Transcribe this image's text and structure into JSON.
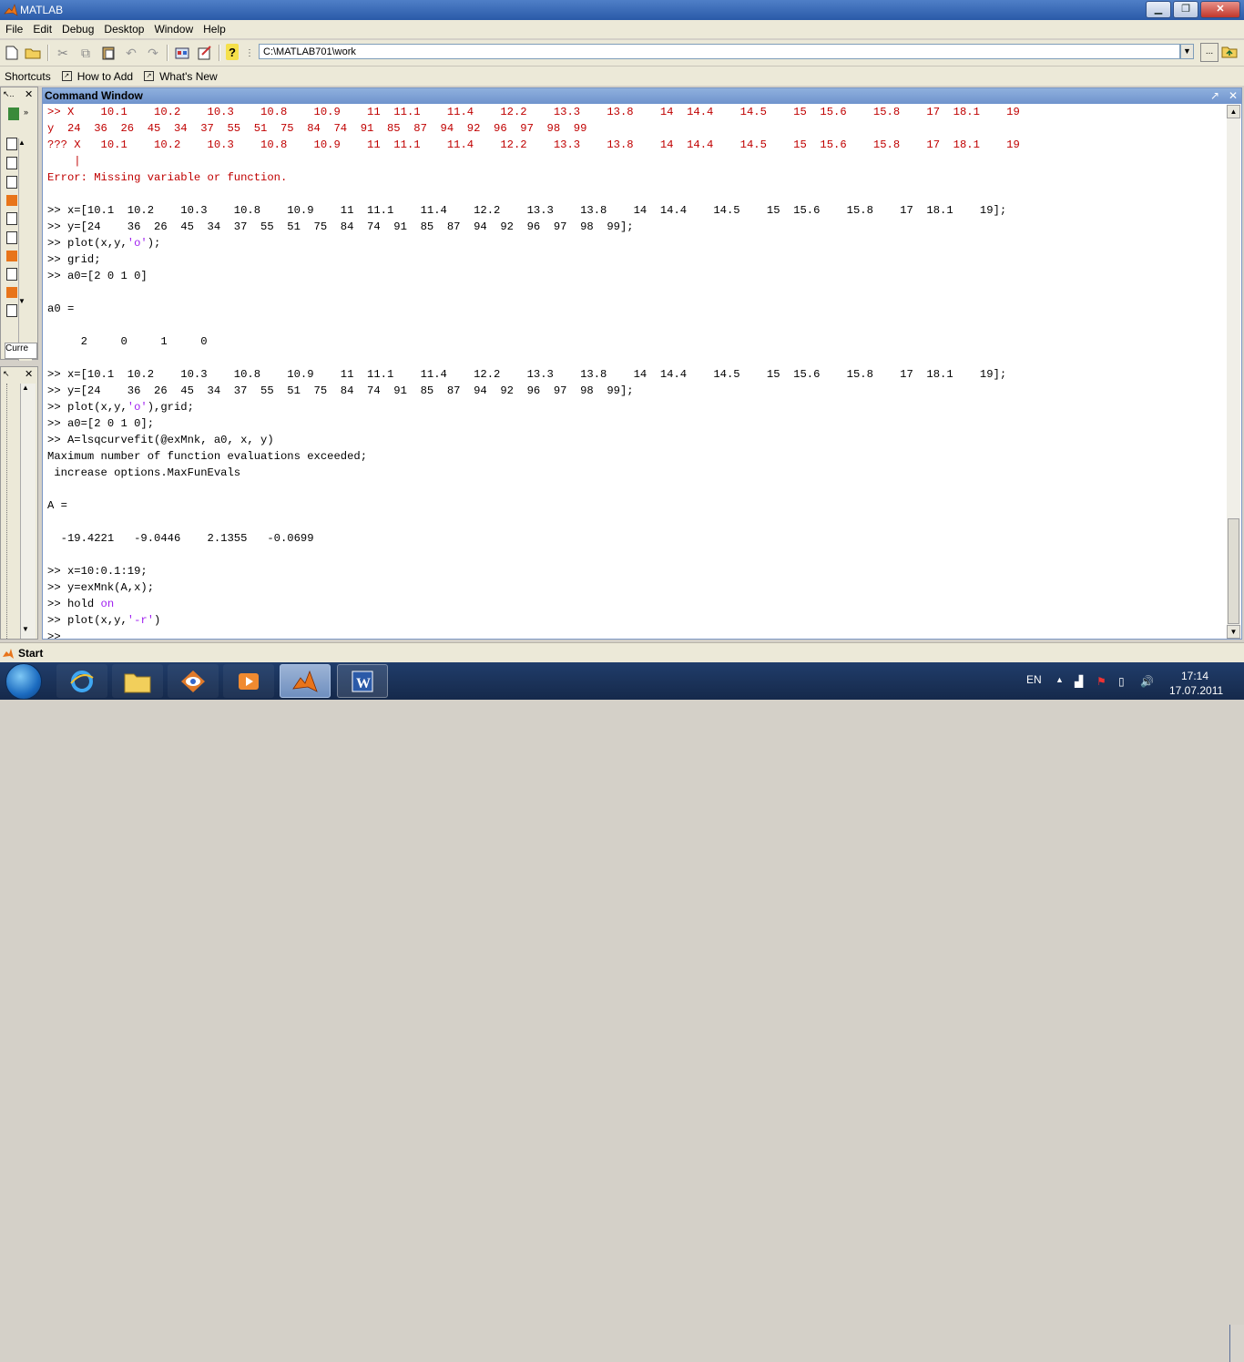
{
  "window": {
    "title": "MATLAB"
  },
  "menu": [
    "File",
    "Edit",
    "Debug",
    "Desktop",
    "Window",
    "Help"
  ],
  "toolbar": {
    "current_directory": "C:\\MATLAB701\\work",
    "browse_label": "..."
  },
  "shortcuts": {
    "label": "Shortcuts",
    "items": [
      "How to Add",
      "What's New"
    ]
  },
  "left_panel": {
    "tab_label": "Curre"
  },
  "command_window": {
    "title": "Command Window",
    "lines": [
      [
        {
          "t": ">> X    10.1    10.2    10.3    10.8    10.9    11  11.1    11.4    12.2    13.3    13.8    14  14.4    14.5    15  15.6    15.8    17  18.1    19",
          "c": "red"
        }
      ],
      [
        {
          "t": "y  24  36  26  45  34  37  55  51  75  84  74  91  85  87  94  92  96  97  98  99",
          "c": "red"
        }
      ],
      [
        {
          "t": "??? X   10.1    10.2    10.3    10.8    10.9    11  11.1    11.4    12.2    13.3    13.8    14  14.4    14.5    15  15.6    15.8    17  18.1    19",
          "c": "red"
        }
      ],
      [
        {
          "t": "    |",
          "c": "red"
        }
      ],
      [
        {
          "t": "Error: Missing variable or function.",
          "c": "red"
        }
      ],
      [
        {
          "t": ""
        }
      ],
      [
        {
          "t": ">> x=[10.1  10.2    10.3    10.8    10.9    11  11.1    11.4    12.2    13.3    13.8    14  14.4    14.5    15  15.6    15.8    17  18.1    19];"
        }
      ],
      [
        {
          "t": ">> y=[24    36  26  45  34  37  55  51  75  84  74  91  85  87  94  92  96  97  98  99];"
        }
      ],
      [
        {
          "t": ">> plot(x,y,"
        },
        {
          "t": "'o'",
          "c": "str"
        },
        {
          "t": ");"
        }
      ],
      [
        {
          "t": ">> grid;"
        }
      ],
      [
        {
          "t": ">> a0=[2 0 1 0]"
        }
      ],
      [
        {
          "t": ""
        }
      ],
      [
        {
          "t": "a0 ="
        }
      ],
      [
        {
          "t": ""
        }
      ],
      [
        {
          "t": "     2     0     1     0"
        }
      ],
      [
        {
          "t": ""
        }
      ],
      [
        {
          "t": ">> x=[10.1  10.2    10.3    10.8    10.9    11  11.1    11.4    12.2    13.3    13.8    14  14.4    14.5    15  15.6    15.8    17  18.1    19];"
        }
      ],
      [
        {
          "t": ">> y=[24    36  26  45  34  37  55  51  75  84  74  91  85  87  94  92  96  97  98  99];"
        }
      ],
      [
        {
          "t": ">> plot(x,y,"
        },
        {
          "t": "'o'",
          "c": "str"
        },
        {
          "t": "),grid;"
        }
      ],
      [
        {
          "t": ">> a0=[2 0 1 0];"
        }
      ],
      [
        {
          "t": ">> A=lsqcurvefit(@exMnk, a0, x, y)"
        }
      ],
      [
        {
          "t": "Maximum number of function evaluations exceeded;"
        }
      ],
      [
        {
          "t": " increase options.MaxFunEvals"
        }
      ],
      [
        {
          "t": ""
        }
      ],
      [
        {
          "t": "A ="
        }
      ],
      [
        {
          "t": ""
        }
      ],
      [
        {
          "t": "  -19.4221   -9.0446    2.1355   -0.0699"
        }
      ],
      [
        {
          "t": ""
        }
      ],
      [
        {
          "t": ">> x=10:0.1:19;"
        }
      ],
      [
        {
          "t": ">> y=exMnk(A,x);"
        }
      ],
      [
        {
          "t": ">> hold "
        },
        {
          "t": "on",
          "c": "str"
        }
      ],
      [
        {
          "t": ">> plot(x,y,"
        },
        {
          "t": "'-r'",
          "c": "str"
        },
        {
          "t": ")"
        }
      ],
      [
        {
          "t": ">> "
        }
      ]
    ]
  },
  "start_bar": {
    "label": "Start"
  },
  "taskbar": {
    "apps": [
      "internet-explorer-icon",
      "folder-icon",
      "eye-app-icon",
      "media-player-icon",
      "matlab-icon",
      "word-icon"
    ],
    "language": "EN",
    "time": "17:14",
    "date": "17.07.2011"
  }
}
